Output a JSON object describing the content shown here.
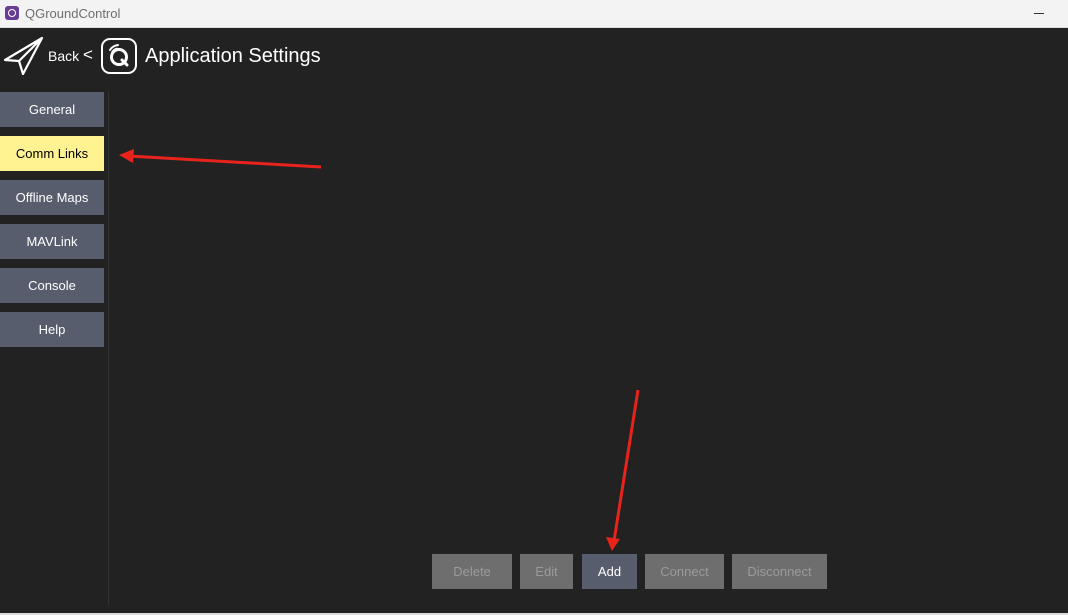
{
  "window": {
    "title": "QGroundControl"
  },
  "header": {
    "back_label": "Back",
    "separator": "<",
    "title": "Application Settings"
  },
  "sidebar": {
    "items": [
      {
        "label": "General",
        "selected": false
      },
      {
        "label": "Comm Links",
        "selected": true
      },
      {
        "label": "Offline Maps",
        "selected": false
      },
      {
        "label": "MAVLink",
        "selected": false
      },
      {
        "label": "Console",
        "selected": false
      },
      {
        "label": "Help",
        "selected": false
      }
    ]
  },
  "actions": {
    "delete": {
      "label": "Delete",
      "enabled": false
    },
    "edit": {
      "label": "Edit",
      "enabled": false
    },
    "add": {
      "label": "Add",
      "enabled": true
    },
    "connect": {
      "label": "Connect",
      "enabled": false
    },
    "disconnect": {
      "label": "Disconnect",
      "enabled": false
    }
  },
  "colors": {
    "background": "#222222",
    "nav_button": "#585d6e",
    "nav_selected": "#fff291",
    "button_disabled": "#6e6e6e",
    "annotation_arrow": "#e8231c"
  }
}
